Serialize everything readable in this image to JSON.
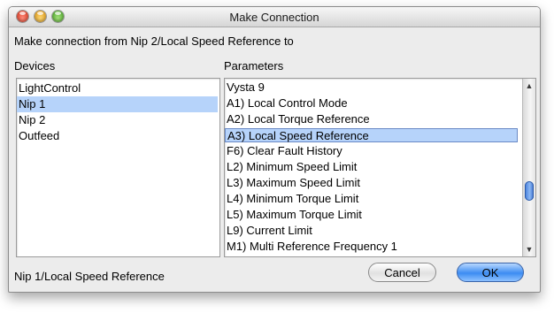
{
  "window": {
    "title": "Make Connection"
  },
  "prompt": "Make connection from Nip 2/Local Speed Reference to",
  "devices": {
    "label": "Devices",
    "items": [
      "LightControl",
      "Nip 1",
      "Nip 2",
      "Outfeed"
    ],
    "selected": "Nip 1"
  },
  "parameters": {
    "label": "Parameters",
    "items": [
      "Vysta 9",
      "A1) Local Control Mode",
      "A2) Local Torque Reference",
      "A3) Local Speed Reference",
      "F6) Clear Fault History",
      "L2) Minimum Speed Limit",
      "L3) Maximum Speed Limit",
      "L4) Minimum Torque Limit",
      "L5) Maximum Torque Limit",
      "L9) Current Limit",
      "M1) Multi Reference Frequency 1"
    ],
    "selected": "A3) Local Speed Reference"
  },
  "status": "Nip 1/Local Speed Reference",
  "buttons": {
    "cancel": "Cancel",
    "ok": "OK"
  },
  "icons": {
    "close": "close-icon",
    "minimize": "minimize-icon",
    "zoom": "zoom-icon",
    "scroll_up": "chevron-up-icon",
    "scroll_down": "chevron-down-icon"
  },
  "colors": {
    "selection": "#b6d3fa",
    "default_button": "#3c8cf2"
  }
}
